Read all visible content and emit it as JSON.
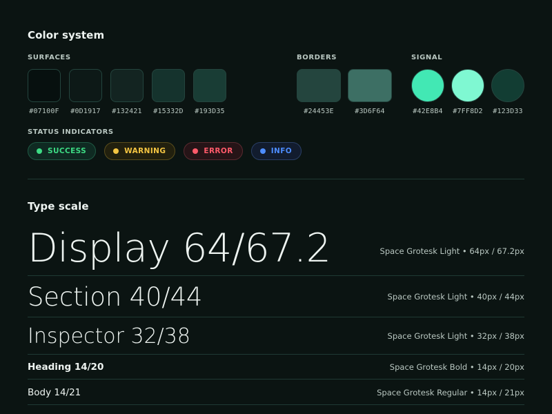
{
  "color_system": {
    "title": "Color system",
    "surfaces": {
      "label": "SURFACES",
      "swatches": [
        {
          "hex": "#07100F",
          "color": "#07100f"
        },
        {
          "hex": "#0D1917",
          "color": "#0d1917"
        },
        {
          "hex": "#132421",
          "color": "#132421"
        },
        {
          "hex": "#15332D",
          "color": "#15332d"
        },
        {
          "hex": "#193D35",
          "color": "#193d35"
        }
      ]
    },
    "borders": {
      "label": "BORDERS",
      "swatches": [
        {
          "hex": "#24453E",
          "color": "#24453e"
        },
        {
          "hex": "#3D6F64",
          "color": "#3d6f64"
        }
      ]
    },
    "signal": {
      "label": "SIGNAL",
      "swatches": [
        {
          "hex": "#42E8B4",
          "color": "#42e8b4"
        },
        {
          "hex": "#7FF8D2",
          "color": "#7ff8d2"
        },
        {
          "hex": "#123D33",
          "color": "#123d33"
        }
      ]
    },
    "status": {
      "label": "STATUS INDICATORS",
      "items": [
        {
          "label": "SUCCESS",
          "color": "#3ddc84",
          "bg": "#0f2a22",
          "border": "#1f5a44"
        },
        {
          "label": "WARNING",
          "color": "#f4c542",
          "bg": "#22200e",
          "border": "#5a4d1c"
        },
        {
          "label": "ERROR",
          "color": "#ff5a6a",
          "bg": "#261417",
          "border": "#5a2a30"
        },
        {
          "label": "INFO",
          "color": "#4d8dff",
          "bg": "#121c2e",
          "border": "#2a3f66"
        }
      ]
    }
  },
  "type_scale": {
    "title": "Type scale",
    "rows": [
      {
        "sample": "Display 64/67.2",
        "spec": "Space Grotesk Light • 64px / 67.2px"
      },
      {
        "sample": "Section 40/44",
        "spec": "Space Grotesk Light • 40px / 44px"
      },
      {
        "sample": "Inspector 32/38",
        "spec": "Space Grotesk Light • 32px / 38px"
      },
      {
        "sample": "Heading 14/20",
        "spec": "Space Grotesk Bold • 14px / 20px"
      },
      {
        "sample": "Body 14/21",
        "spec": "Space Grotesk Regular • 14px / 21px"
      }
    ]
  }
}
